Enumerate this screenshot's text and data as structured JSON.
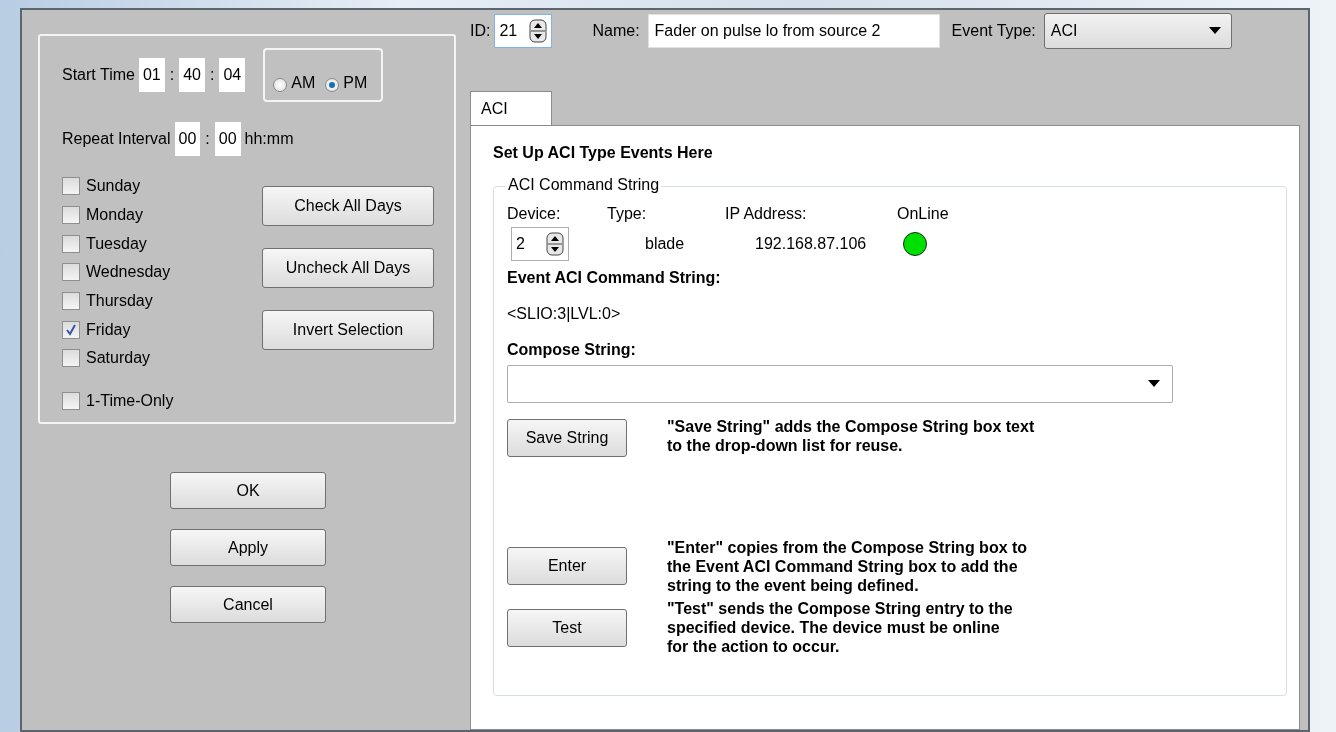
{
  "start_time": {
    "label": "Start Time",
    "parts": [
      {
        "kind": "field",
        "value": "01"
      },
      {
        "kind": "separator",
        "text": ":"
      },
      {
        "kind": "field",
        "value": "40"
      },
      {
        "kind": "separator",
        "text": ":"
      },
      {
        "kind": "field",
        "value": "04"
      }
    ]
  },
  "meridiem": [
    {
      "label": "AM",
      "selected": false
    },
    {
      "label": "PM",
      "selected": true
    }
  ],
  "repeat_interval": {
    "label": "Repeat Interval",
    "parts": [
      {
        "kind": "field",
        "value": "00"
      },
      {
        "kind": "separator",
        "text": ":"
      },
      {
        "kind": "field",
        "value": "00"
      }
    ],
    "unit": "hh:mm"
  },
  "days": [
    {
      "label": "Sunday",
      "checked": false
    },
    {
      "label": "Monday",
      "checked": false
    },
    {
      "label": "Tuesday",
      "checked": false
    },
    {
      "label": "Wednesday",
      "checked": false
    },
    {
      "label": "Thursday",
      "checked": false
    },
    {
      "label": "Friday",
      "checked": true
    },
    {
      "label": "Saturday",
      "checked": false
    }
  ],
  "day_buttons": [
    "Check All Days",
    "Uncheck All Days",
    "Invert Selection"
  ],
  "one_time_only": {
    "label": "1-Time-Only",
    "checked": false
  },
  "dialog_buttons": [
    "OK",
    "Apply",
    "Cancel"
  ],
  "header": {
    "id": {
      "label": "ID:",
      "value": "21"
    },
    "name": {
      "label": "Name:",
      "value": "Fader on pulse lo from source 2"
    },
    "event_type": {
      "label": "Event Type:",
      "value": "ACI"
    }
  },
  "tabs": [
    {
      "label": "ACI",
      "selected": true
    }
  ],
  "panel": {
    "heading": "Set Up ACI Type Events Here",
    "group": {
      "title": "ACI Command String",
      "columns": [
        "Device:",
        "Type:",
        "IP Address:",
        "OnLine"
      ],
      "device": "2",
      "type": "blade",
      "ip_address": "192.168.87.106",
      "online": true,
      "event_command": {
        "label": "Event ACI Command String:",
        "value": "<SLIO:3|LVL:0>"
      },
      "compose": {
        "label": "Compose String:"
      },
      "actions": [
        {
          "button": "Save String",
          "description": [
            "\"Save String\" adds the Compose String box text",
            "to the drop-down list for reuse."
          ]
        },
        {
          "button": "Enter",
          "description": [
            "\"Enter\" copies from the Compose String box to",
            "the Event ACI Command String box to add the",
            "string to the event being defined."
          ]
        },
        {
          "button": "Test",
          "description": [
            "\"Test\" sends the Compose String entry to the",
            "specified device.  The device must be online",
            "for the action to occur."
          ]
        }
      ]
    }
  }
}
